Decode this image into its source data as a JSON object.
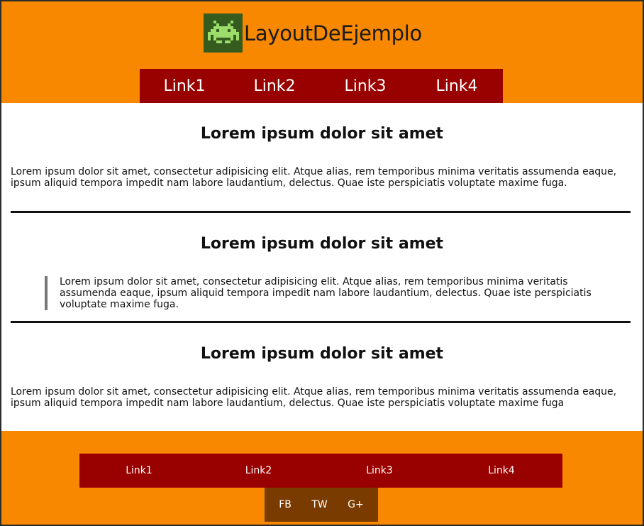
{
  "header": {
    "brand": "LayoutDeEjemplo",
    "logo_icon": "space-invader-icon",
    "nav": [
      "Link1",
      "Link2",
      "Link3",
      "Link4"
    ]
  },
  "sections": [
    {
      "title": "Lorem ipsum dolor sit amet",
      "text": "Lorem ipsum dolor sit amet, consectetur adipisicing elit. Atque alias, rem temporibus minima veritatis assumenda eaque, ipsum aliquid tempora impedit nam labore laudantium, delectus. Quae iste perspiciatis voluptate maxime fuga."
    },
    {
      "title": "Lorem ipsum dolor sit amet",
      "quote": "Lorem ipsum dolor sit amet, consectetur adipisicing elit. Atque alias, rem temporibus minima veritatis assumenda eaque, ipsum aliquid tempora impedit nam labore laudantium, delectus. Quae iste perspiciatis voluptate maxime fuga."
    },
    {
      "title": "Lorem ipsum dolor sit amet",
      "text": "Lorem ipsum dolor sit amet, consectetur adipisicing elit. Atque alias, rem temporibus minima veritatis assumenda eaque, ipsum aliquid tempora impedit nam labore laudantium, delectus. Quae iste perspiciatis voluptate maxime fuga"
    }
  ],
  "footer": {
    "nav": [
      "Link1",
      "Link2",
      "Link3",
      "Link4"
    ],
    "social": [
      "FB",
      "TW",
      "G+"
    ]
  },
  "colors": {
    "orange": "#f78800",
    "dark_red": "#990000",
    "brown": "#7a3b00",
    "logo_bg": "#355b1e",
    "logo_fg": "#9bdc6a"
  }
}
